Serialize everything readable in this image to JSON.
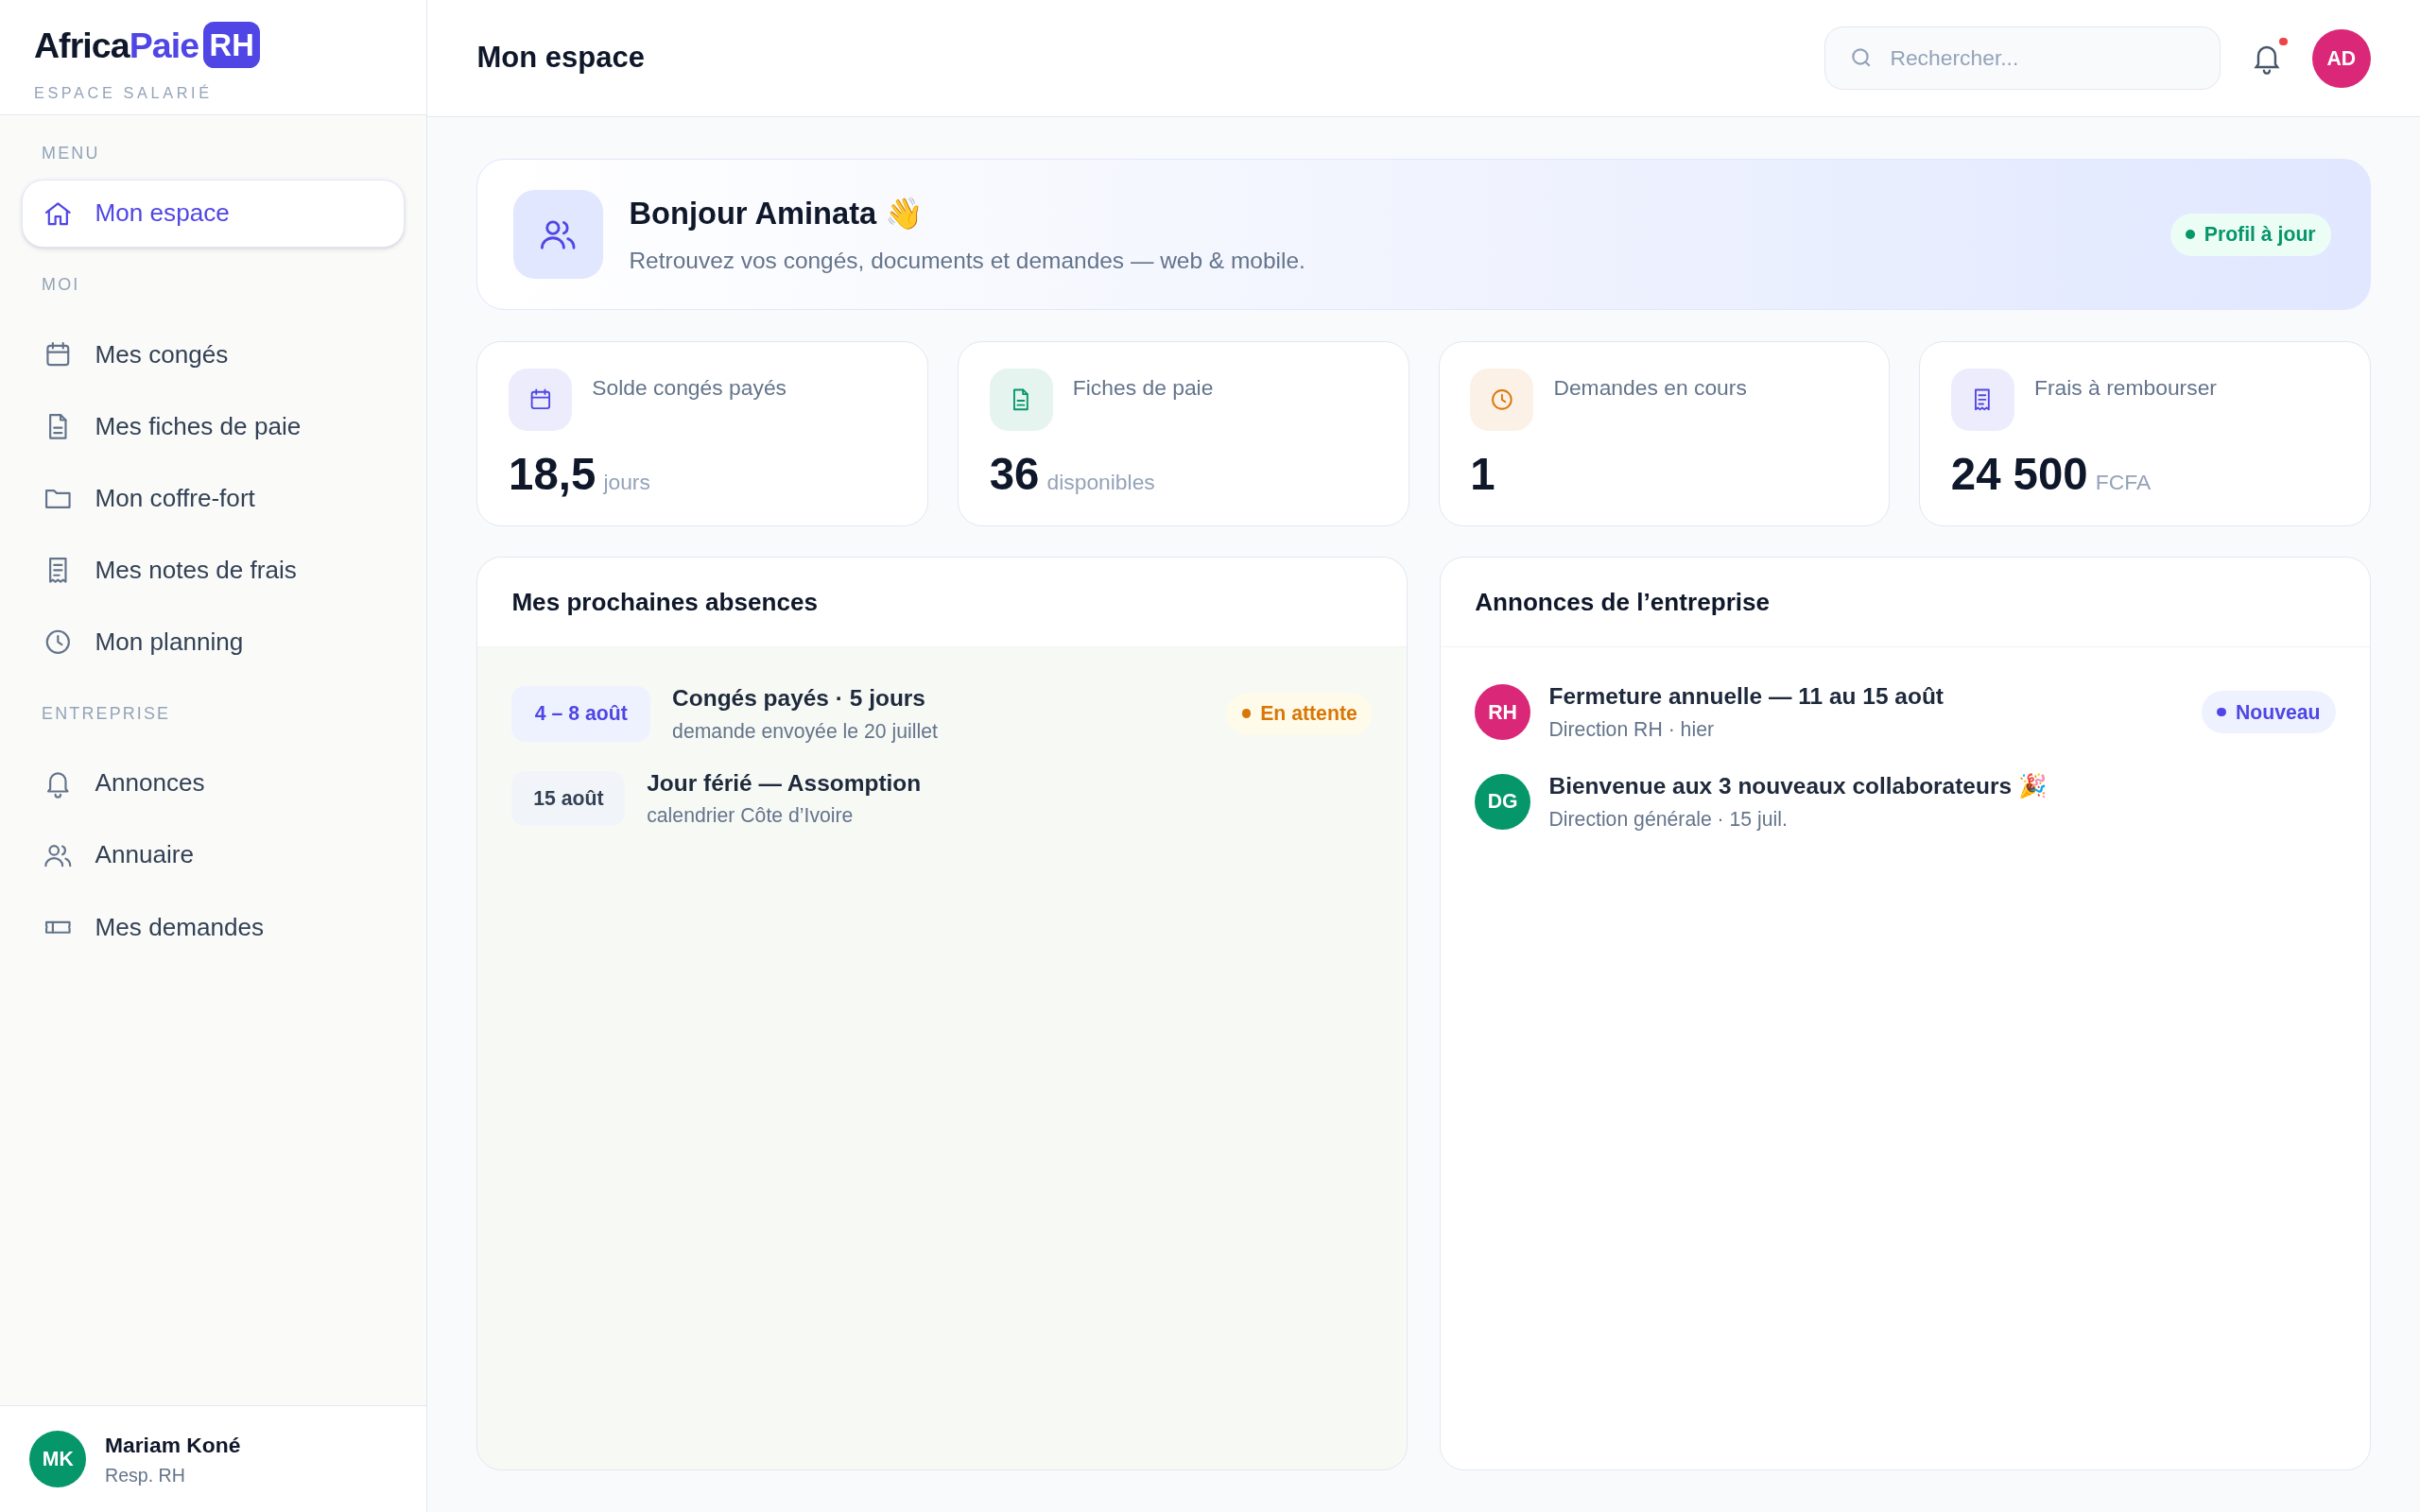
{
  "brand": {
    "name_first": "Africa",
    "name_second": "Paie",
    "name_badge": "RH",
    "subtitle": "ESPACE SALARIÉ"
  },
  "sidebar": {
    "sections": [
      {
        "label": "MENU",
        "items": [
          {
            "label": "Mon espace",
            "selected": true
          }
        ]
      },
      {
        "label": "MOI",
        "items": [
          {
            "label": "Mes congés",
            "selected": false
          },
          {
            "label": "Mes fiches de paie",
            "selected": false
          },
          {
            "label": "Mon coffre-fort",
            "selected": false
          },
          {
            "label": "Mes notes de frais",
            "selected": false
          },
          {
            "label": "Mon planning",
            "selected": false
          }
        ]
      },
      {
        "label": "ENTREPRISE",
        "items": [
          {
            "label": "Annonces",
            "selected": false
          },
          {
            "label": "Annuaire",
            "selected": false
          },
          {
            "label": "Mes demandes",
            "selected": false
          }
        ]
      }
    ],
    "user": {
      "initials": "MK",
      "name": "Mariam Koné",
      "role": "Resp. RH",
      "color": "#059669"
    }
  },
  "header": {
    "title": "Mon espace",
    "search": {
      "placeholder": "Rechercher..."
    },
    "notifications": {
      "unread": true
    },
    "avatar": {
      "initials": "AD",
      "color": "#db2777"
    }
  },
  "welcome": {
    "title": "Bonjour Aminata 👋",
    "subtitle": "Retrouvez vos congés, documents et demandes — web & mobile.",
    "badge": "Profil à jour"
  },
  "stats": [
    {
      "label": "Solde congés payés",
      "value": "18,5",
      "unit": "jours",
      "color": "#4f46e5"
    },
    {
      "label": "Fiches de paie",
      "value": "36",
      "unit": "disponibles",
      "color": "#059669"
    },
    {
      "label": "Demandes en cours",
      "value": "1",
      "color": "#d97706"
    },
    {
      "label": "Frais à rembourser",
      "value": "24 500",
      "unit": "FCFA",
      "color": "#4f46e5"
    }
  ],
  "absences": {
    "title": "Mes prochaines absences",
    "rows": [
      {
        "kind": "leave",
        "date": "4 – 8 août",
        "title": "Congés payés · 5 jours",
        "detail": "demande envoyée le 20 juillet",
        "badge": {
          "text": "En attente",
          "kind": "pending"
        }
      },
      {
        "kind": "holiday",
        "date": "15 août",
        "title": "Jour férié — Assomption",
        "detail": "calendrier Côte d’Ivoire"
      }
    ]
  },
  "announcements": {
    "title": "Annonces de l’entreprise",
    "rows": [
      {
        "initials": "RH",
        "color": "#db2777",
        "title": "Fermeture annuelle — 11 au 15 août",
        "detail": "Direction RH · hier",
        "badge": {
          "text": "Nouveau",
          "kind": "new"
        }
      },
      {
        "initials": "DG",
        "color": "#059669",
        "title": "Bienvenue aux 3 nouveaux collaborateurs 🎉",
        "detail": "Direction générale · 15 juil."
      }
    ]
  }
}
